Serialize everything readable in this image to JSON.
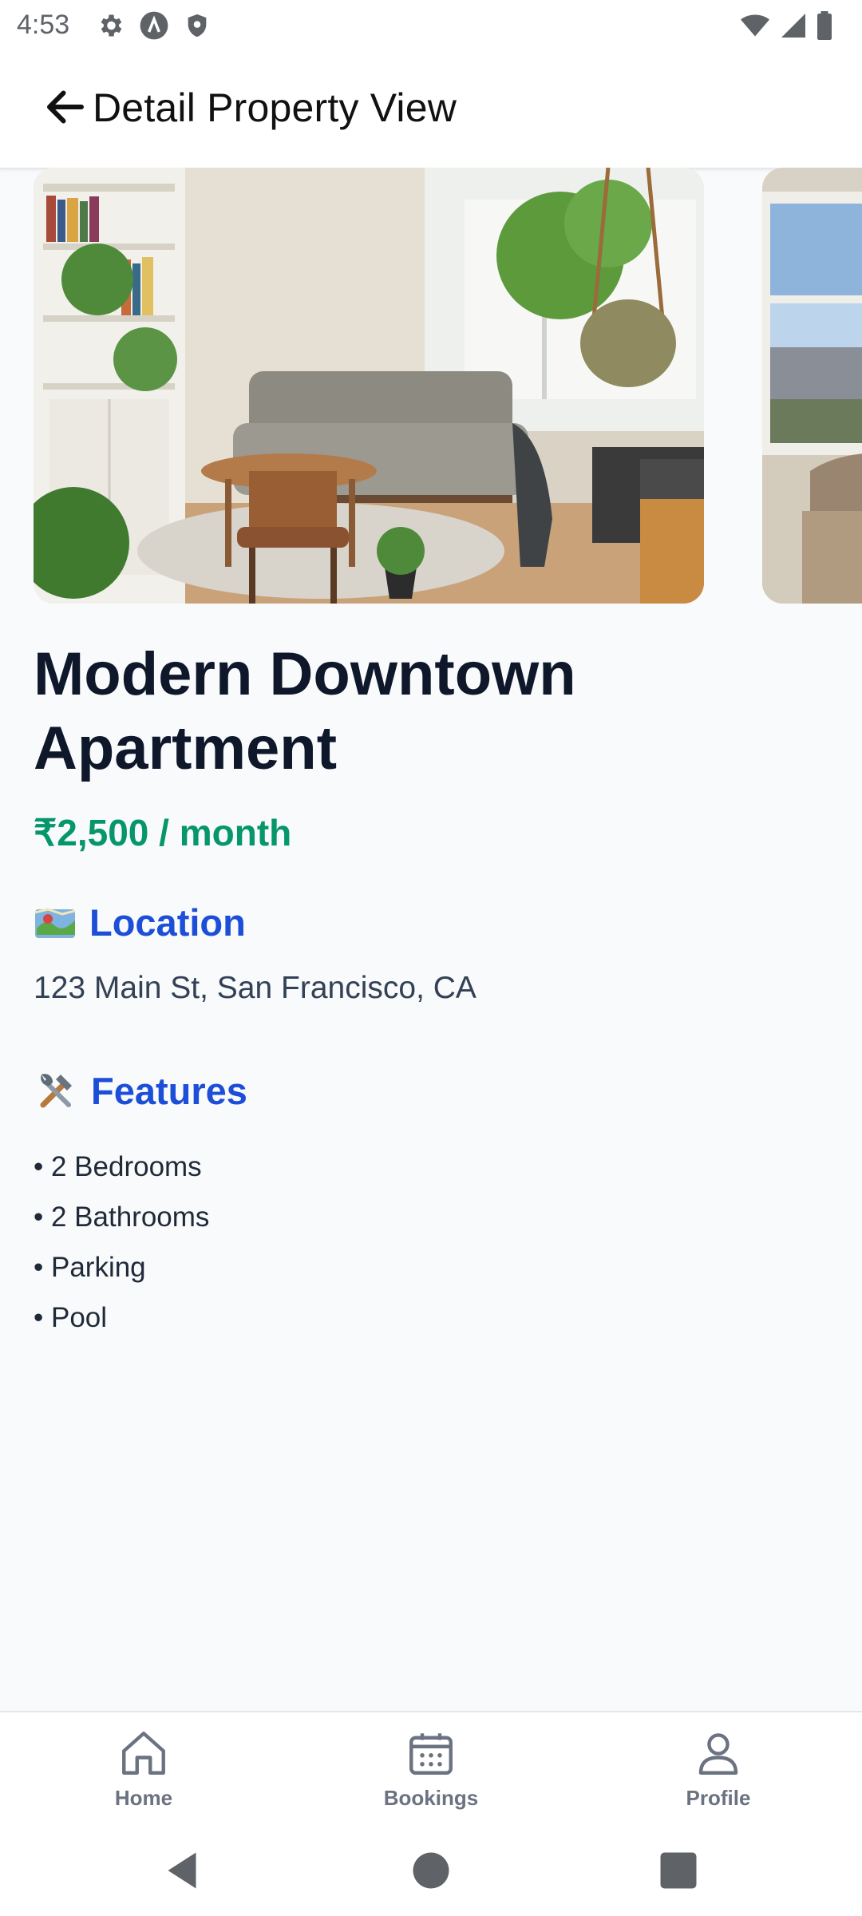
{
  "status_bar": {
    "time": "4:53",
    "left_icons": [
      "settings-icon",
      "a-logo-icon",
      "shield-icon"
    ],
    "right_icons": [
      "wifi-icon",
      "signal-icon",
      "battery-icon"
    ]
  },
  "app_bar": {
    "title": "Detail Property View",
    "back_icon": "arrow-left-icon"
  },
  "gallery": {
    "images": [
      "living-room-photo",
      "window-room-photo"
    ]
  },
  "property": {
    "title": "Modern Downtown Apartment",
    "price": "₹2,500 / month",
    "location_heading": "Location",
    "location_emoji": "🗺️",
    "address": "123 Main St, San Francisco, CA",
    "features_heading": "Features",
    "features_emoji": "🛠️",
    "features": [
      "• 2 Bedrooms",
      "• 2 Bathrooms",
      "• Parking",
      "• Pool"
    ]
  },
  "bottom_nav": {
    "items": [
      {
        "label": "Home",
        "icon": "home-icon"
      },
      {
        "label": "Bookings",
        "icon": "calendar-icon"
      },
      {
        "label": "Profile",
        "icon": "user-icon"
      }
    ]
  },
  "system_nav": {
    "buttons": [
      "back-triangle-icon",
      "home-circle-icon",
      "recents-square-icon"
    ]
  },
  "colors": {
    "price": "#059669",
    "section_heading": "#1d4ed8",
    "title": "#0f172a",
    "background": "#f8fafc"
  }
}
